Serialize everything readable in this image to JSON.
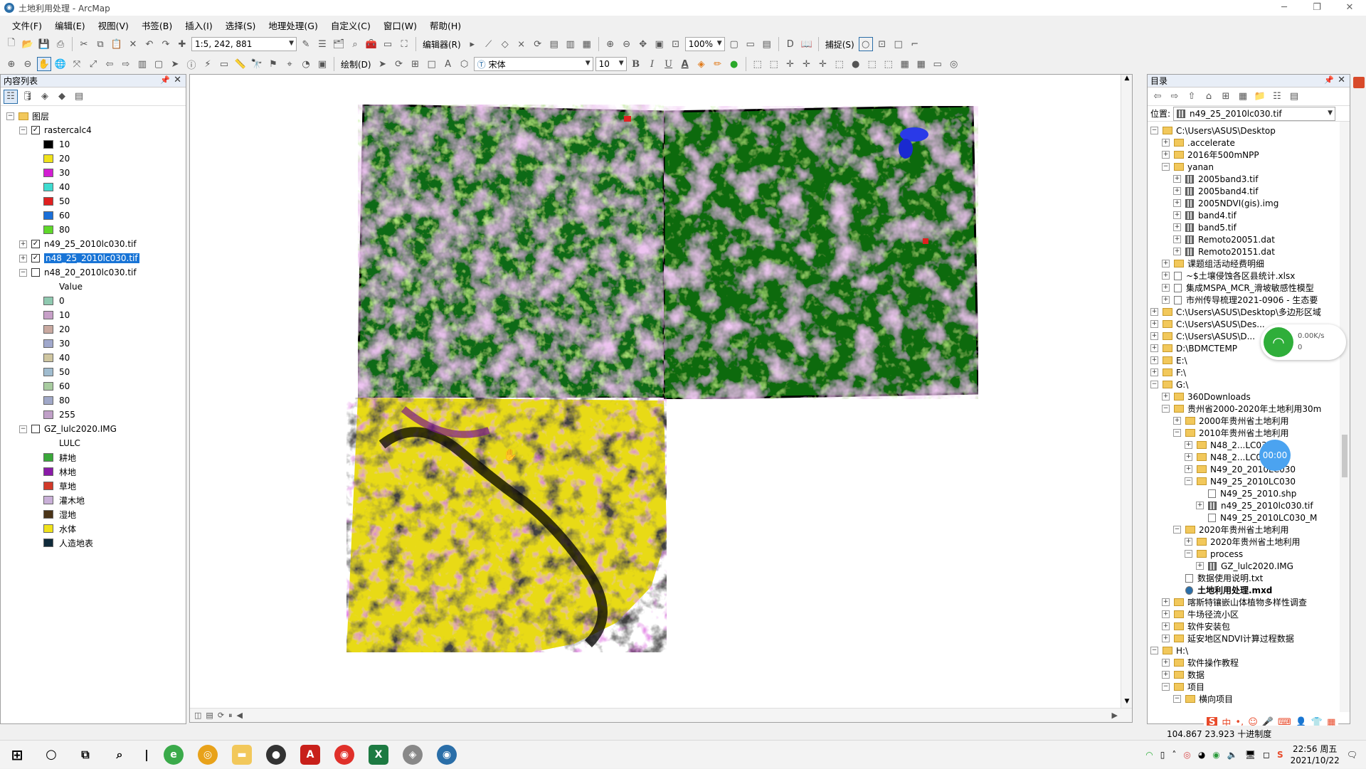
{
  "window": {
    "title": "土地利用处理 - ArcMap"
  },
  "menu": [
    "文件(F)",
    "编辑(E)",
    "视图(V)",
    "书签(B)",
    "插入(I)",
    "选择(S)",
    "地理处理(G)",
    "自定义(C)",
    "窗口(W)",
    "帮助(H)"
  ],
  "toolbar": {
    "scale": "1:5, 242, 881",
    "editor_label": "编辑器(R)",
    "zoom_percent": "100%",
    "snap_label": "捕捉(S)",
    "draw_label": "绘制(D)",
    "font_name": "宋体",
    "font_size": "10",
    "bold": "B",
    "italic": "I",
    "underline": "U",
    "font_color": "A"
  },
  "toc": {
    "header": "内容列表",
    "root": "图层",
    "layers": [
      {
        "name": "rastercalc4",
        "checked": true,
        "expanded": true,
        "field": "",
        "classes": [
          {
            "label": "10",
            "color": "#000000"
          },
          {
            "label": "20",
            "color": "#f0e21a"
          },
          {
            "label": "30",
            "color": "#d21ed2"
          },
          {
            "label": "40",
            "color": "#3fdcd0"
          },
          {
            "label": "50",
            "color": "#e02020"
          },
          {
            "label": "60",
            "color": "#1a6fd8"
          },
          {
            "label": "80",
            "color": "#5fd82a"
          }
        ]
      },
      {
        "name": "n49_25_2010lc030.tif",
        "checked": true,
        "expanded": false,
        "selected": false,
        "field": "",
        "classes": []
      },
      {
        "name": "n48_25_2010lc030.tif",
        "checked": true,
        "expanded": false,
        "selected": true,
        "field": "",
        "classes": []
      },
      {
        "name": "n48_20_2010lc030.tif",
        "checked": false,
        "expanded": true,
        "field": "Value",
        "classes": [
          {
            "label": "0",
            "color": "#8fc9b0"
          },
          {
            "label": "10",
            "color": "#c7a0c8"
          },
          {
            "label": "20",
            "color": "#c9a9a0"
          },
          {
            "label": "30",
            "color": "#a0a8cc"
          },
          {
            "label": "40",
            "color": "#cfc6a0"
          },
          {
            "label": "50",
            "color": "#a0bccf"
          },
          {
            "label": "60",
            "color": "#a8cca0"
          },
          {
            "label": "80",
            "color": "#a0a8c8"
          },
          {
            "label": "255",
            "color": "#c0a0c8"
          }
        ]
      },
      {
        "name": "GZ_lulc2020.IMG",
        "checked": false,
        "expanded": true,
        "field": "LULC",
        "classes": [
          {
            "label": "耕地",
            "color": "#3aa83a"
          },
          {
            "label": "林地",
            "color": "#8a1aa8"
          },
          {
            "label": "草地",
            "color": "#d23a2a"
          },
          {
            "label": "灌木地",
            "color": "#c9b0d8"
          },
          {
            "label": "湿地",
            "color": "#4a3418"
          },
          {
            "label": "水体",
            "color": "#f0e21a"
          },
          {
            "label": "人造地表",
            "color": "#0f2a3a"
          }
        ]
      }
    ]
  },
  "catalog": {
    "header": "目录",
    "location_label": "位置:",
    "location_value": "n49_25_2010lc030.tif",
    "items": [
      {
        "depth": 1,
        "exp": "-",
        "type": "folder",
        "label": "C:\\Users\\ASUS\\Desktop"
      },
      {
        "depth": 2,
        "exp": "+",
        "type": "folder",
        "label": ".accelerate"
      },
      {
        "depth": 2,
        "exp": "+",
        "type": "folder",
        "label": "2016年500mNPP"
      },
      {
        "depth": 2,
        "exp": "-",
        "type": "folder",
        "label": "yanan"
      },
      {
        "depth": 3,
        "exp": "+",
        "type": "raster",
        "label": "2005band3.tif"
      },
      {
        "depth": 3,
        "exp": "+",
        "type": "raster",
        "label": "2005band4.tif"
      },
      {
        "depth": 3,
        "exp": "+",
        "type": "raster",
        "label": "2005NDVI(gis).img"
      },
      {
        "depth": 3,
        "exp": "+",
        "type": "raster",
        "label": "band4.tif"
      },
      {
        "depth": 3,
        "exp": "+",
        "type": "raster",
        "label": "band5.tif"
      },
      {
        "depth": 3,
        "exp": "+",
        "type": "raster",
        "label": "Remoto20051.dat"
      },
      {
        "depth": 3,
        "exp": "+",
        "type": "raster",
        "label": "Remoto20151.dat"
      },
      {
        "depth": 2,
        "exp": "+",
        "type": "folder",
        "label": "课题组活动经费明细"
      },
      {
        "depth": 2,
        "exp": "+",
        "type": "file",
        "label": "~$土壤侵蚀各区县统计.xlsx"
      },
      {
        "depth": 2,
        "exp": "+",
        "type": "file",
        "label": "集成MSPA_MCR_滑坡敏感性模型"
      },
      {
        "depth": 2,
        "exp": "+",
        "type": "file",
        "label": "市州传导梳理2021-0906 - 生态要"
      },
      {
        "depth": 1,
        "exp": "+",
        "type": "folder",
        "label": "C:\\Users\\ASUS\\Desktop\\多边形区域"
      },
      {
        "depth": 1,
        "exp": "+",
        "type": "folder",
        "label": "C:\\Users\\ASUS\\Des..."
      },
      {
        "depth": 1,
        "exp": "+",
        "type": "folder",
        "label": "C:\\Users\\ASUS\\D..."
      },
      {
        "depth": 1,
        "exp": "+",
        "type": "folder",
        "label": "D:\\BDMCTEMP"
      },
      {
        "depth": 1,
        "exp": "+",
        "type": "folder",
        "label": "E:\\"
      },
      {
        "depth": 1,
        "exp": "+",
        "type": "folder",
        "label": "F:\\"
      },
      {
        "depth": 1,
        "exp": "-",
        "type": "folder",
        "label": "G:\\"
      },
      {
        "depth": 2,
        "exp": "+",
        "type": "folder",
        "label": "360Downloads"
      },
      {
        "depth": 2,
        "exp": "-",
        "type": "folder",
        "label": "贵州省2000-2020年土地利用30m"
      },
      {
        "depth": 3,
        "exp": "+",
        "type": "folder",
        "label": "2000年贵州省土地利用"
      },
      {
        "depth": 3,
        "exp": "-",
        "type": "folder",
        "label": "2010年贵州省土地利用"
      },
      {
        "depth": 4,
        "exp": "+",
        "type": "folder",
        "label": "N48_2...LC030"
      },
      {
        "depth": 4,
        "exp": "+",
        "type": "folder",
        "label": "N48_2...LC030"
      },
      {
        "depth": 4,
        "exp": "+",
        "type": "folder",
        "label": "N49_20_2010LC030"
      },
      {
        "depth": 4,
        "exp": "-",
        "type": "folder",
        "label": "N49_25_2010LC030"
      },
      {
        "depth": 5,
        "exp": "",
        "type": "file",
        "label": "N49_25_2010.shp"
      },
      {
        "depth": 5,
        "exp": "+",
        "type": "raster",
        "label": "n49_25_2010lc030.tif"
      },
      {
        "depth": 5,
        "exp": "",
        "type": "file",
        "label": "N49_25_2010LC030_M"
      },
      {
        "depth": 3,
        "exp": "-",
        "type": "folder",
        "label": "2020年贵州省土地利用"
      },
      {
        "depth": 4,
        "exp": "+",
        "type": "folder",
        "label": "2020年贵州省土地利用"
      },
      {
        "depth": 4,
        "exp": "-",
        "type": "folder",
        "label": "process"
      },
      {
        "depth": 5,
        "exp": "+",
        "type": "raster",
        "label": "GZ_lulc2020.IMG"
      },
      {
        "depth": 3,
        "exp": "",
        "type": "file",
        "label": "数据使用说明.txt"
      },
      {
        "depth": 3,
        "exp": "",
        "type": "mxd",
        "label": "土地利用处理.mxd"
      },
      {
        "depth": 2,
        "exp": "+",
        "type": "folder",
        "label": "喀斯特镶嵌山体植物多样性调查"
      },
      {
        "depth": 2,
        "exp": "+",
        "type": "folder",
        "label": "牛场径流小区"
      },
      {
        "depth": 2,
        "exp": "+",
        "type": "folder",
        "label": "软件安装包"
      },
      {
        "depth": 2,
        "exp": "+",
        "type": "folder",
        "label": "延安地区NDVI计算过程数据"
      },
      {
        "depth": 1,
        "exp": "-",
        "type": "folder",
        "label": "H:\\"
      },
      {
        "depth": 2,
        "exp": "+",
        "type": "folder",
        "label": "软件操作教程"
      },
      {
        "depth": 2,
        "exp": "+",
        "type": "folder",
        "label": "数据"
      },
      {
        "depth": 2,
        "exp": "-",
        "type": "folder",
        "label": "项目"
      },
      {
        "depth": 3,
        "exp": "-",
        "type": "folder",
        "label": "横向项目"
      }
    ]
  },
  "widgets": {
    "net_speed": "0.00K/s",
    "net_count": "0",
    "timer": "00:00"
  },
  "status": {
    "coords": "104.867  23.923  十进制度"
  },
  "taskbar": {
    "time": "22:56 周五",
    "date": "2021/10/22"
  }
}
